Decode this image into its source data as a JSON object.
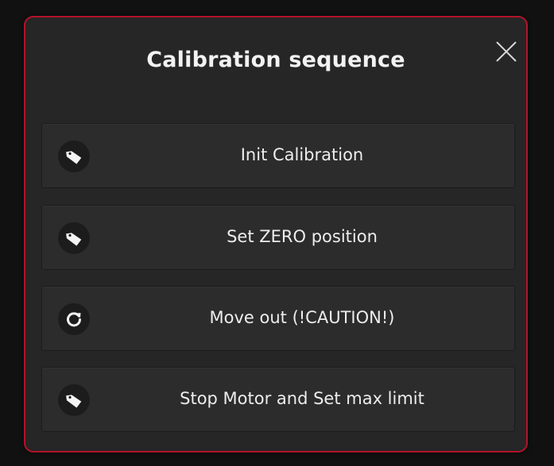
{
  "dialog": {
    "title": "Calibration sequence",
    "accent_color": "#b3132a",
    "close_icon": "close-icon",
    "actions": [
      {
        "label": "Init Calibration",
        "icon": "tag-icon"
      },
      {
        "label": "Set ZERO position",
        "icon": "tag-icon"
      },
      {
        "label": "Move out (!CAUTION!)",
        "icon": "refresh-icon"
      },
      {
        "label": "Stop Motor and Set max limit",
        "icon": "tag-icon"
      }
    ]
  }
}
